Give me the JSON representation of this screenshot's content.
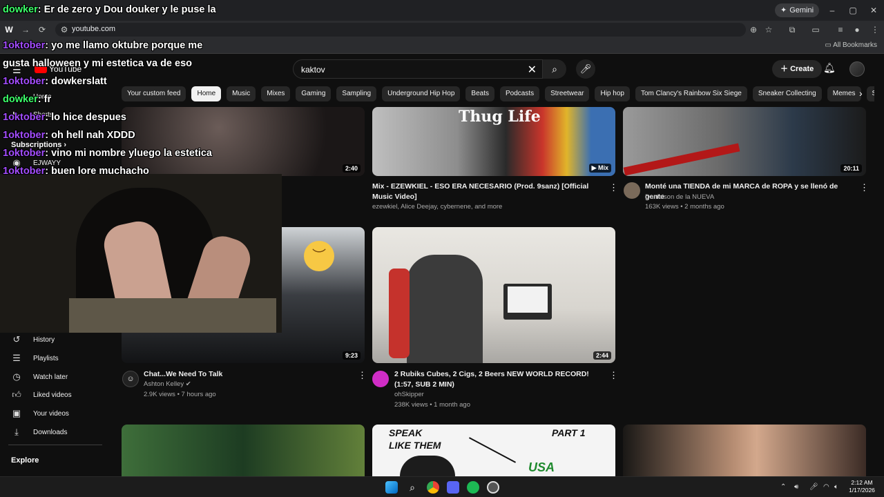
{
  "browser": {
    "url": "youtube.com",
    "gemini_label": "Gemini",
    "all_bookmarks_label": "All Bookmarks",
    "window_controls": [
      "–",
      "▢",
      "✕"
    ]
  },
  "masthead": {
    "logo_text": "YouTube",
    "search_value": "kaktov",
    "create_label": "Create"
  },
  "chips": [
    "Your custom feed",
    "Home",
    "Music",
    "Mixes",
    "Gaming",
    "Sampling",
    "Underground Hip Hop",
    "Beats",
    "Podcasts",
    "Streetwear",
    "Hip hop",
    "Tom Clancy's Rainbow Six Siege",
    "Sneaker Collecting",
    "Memes",
    "Ska"
  ],
  "chips_active": "Home",
  "sidebar": {
    "home": "Home",
    "shorts": "Shorts",
    "subscriptions": "Subscriptions",
    "subscribed_channel": "EJWAYY",
    "history": "History",
    "playlists": "Playlists",
    "watch_later": "Watch later",
    "liked_videos": "Liked videos",
    "your_videos": "Your videos",
    "downloads": "Downloads",
    "explore": "Explore"
  },
  "videos": [
    {
      "duration": "2:40"
    },
    {
      "title": "Mix - EZEWKIEL - ESO ERA NECESARIO (Prod. 9sanz) [Official Music Video]",
      "channel": "ezewkiel, Alice Deejay, cybernene, and more",
      "badge": "Mix"
    },
    {
      "title": "Monté una TIENDA de mi MARCA de ROPA y se llenó de gente",
      "channel": "Danielson de la NUEVA",
      "meta": "163K views • 2 months ago",
      "duration": "20:11"
    },
    {
      "title": "Chat...We Need To Talk",
      "channel": "Ashton Kelley ✔",
      "meta": "2.9K views • 7 hours ago",
      "duration": "9:23"
    },
    {
      "title": "2 Rubiks Cubes, 2 Cigs, 2 Beers NEW WORLD RECORD! (1:57, SUB 2 MIN)",
      "channel": "ohSkipper",
      "meta": "238K views • 1 month ago",
      "duration": "2:44"
    },
    {
      "thumb_text_1": "SPEAK",
      "thumb_text_2": "LIKE THEM",
      "thumb_text_3": "PART 1",
      "thumb_text_4": "USA"
    },
    {
      "thumb_text": "Thug Life"
    }
  ],
  "chat": [
    {
      "user": "dowker",
      "message": "Er de zero y Dou douker y le puse la"
    },
    {
      "user": "1oktober",
      "message": "yo me llamo oktubre porque me"
    },
    {
      "user": "",
      "message": "gusta halloween y mi estetica va de eso"
    },
    {
      "user": "1oktober",
      "message": "dowkerslatt"
    },
    {
      "user": "dowker",
      "message": "fr"
    },
    {
      "user": "1oktober",
      "message": "lo hice despues"
    },
    {
      "user": "1oktober",
      "message": "oh hell nah XDDD"
    },
    {
      "user": "1oktober",
      "message": "vino mi nombre yluego la estetica"
    },
    {
      "user": "1oktober",
      "message": "buen lore muchacho"
    }
  ],
  "taskbar": {
    "time": "2:12 AM",
    "date": "1/17/2026"
  }
}
